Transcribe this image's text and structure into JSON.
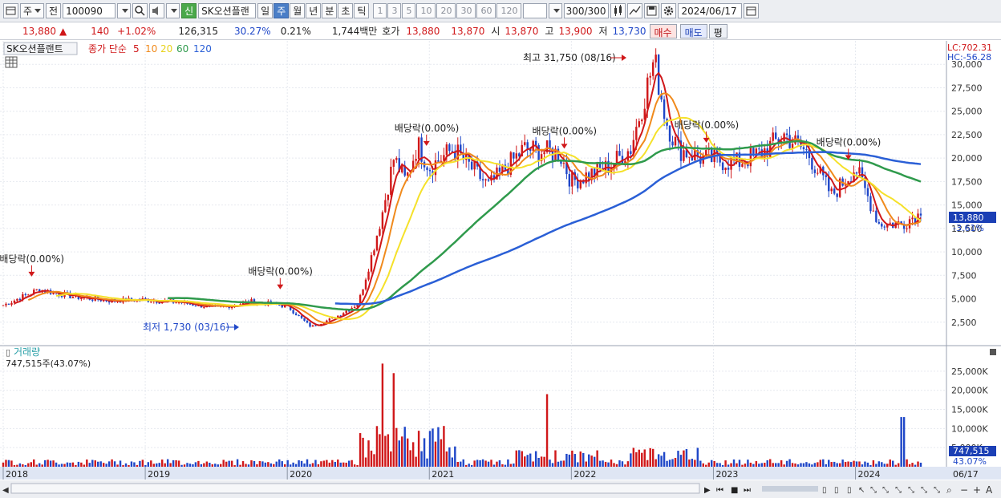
{
  "toolbar": {
    "market_selector": "주",
    "prev_button": "전",
    "stock_code": "100090",
    "new_badge": "신",
    "stock_name": "SK오션플랜",
    "period_tabs": [
      "일",
      "주",
      "월",
      "년",
      "분",
      "초",
      "틱"
    ],
    "selected_period": "주",
    "interval_buttons": [
      "1",
      "3",
      "5",
      "10",
      "20",
      "30",
      "60",
      "120"
    ],
    "count_value": "300",
    "count_total": "/300",
    "date_value": "2024/06/17"
  },
  "quote": {
    "price": "13,880",
    "change_arrow": "▲",
    "change": "140",
    "change_pct": "+1.02%",
    "volume": "126,315",
    "volume_ratio": "30.27%",
    "turnover": "0.21%",
    "amount": "1,744백만",
    "bid_label": "호가",
    "bid1": "13,880",
    "bid2": "13,870",
    "open_label": "시",
    "open": "13,870",
    "high_label": "고",
    "high": "13,900",
    "low_label": "저",
    "low": "13,730",
    "buy_button": "매수",
    "sell_button": "매도",
    "avg_button": "평"
  },
  "legend": {
    "name": "SK오션플랜트",
    "indicator": "종가 단순",
    "periods": [
      "5",
      "10",
      "20",
      "60",
      "120"
    ],
    "colors": [
      "#d0181a",
      "#f08a1c",
      "#f5e12a",
      "#2f9a4c",
      "#2a5fd6"
    ]
  },
  "right_labels": {
    "lc": "LC:702.31",
    "hc": "HC:-56.28",
    "current_price": "13,880",
    "current_pct": "-3.61%",
    "volume_current": "747,515",
    "volume_pct": "43.07%"
  },
  "annotations": {
    "high": "최고 31,750 (08/16)",
    "low": "최저 1,730 (03/16)",
    "dividend": "배당락(0.00%)"
  },
  "volume_panel": {
    "title": "거래량",
    "value": "747,515주(43.07%)"
  },
  "x_axis_labels": [
    "2018",
    "2019",
    "2020",
    "2021",
    "2022",
    "2023",
    "2024",
    "06/17"
  ],
  "price_axis_ticks": [
    "30,000",
    "27,500",
    "25,000",
    "22,500",
    "20,000",
    "17,500",
    "15,000",
    "12,500",
    "10,000",
    "7,500",
    "5,000",
    "2,500"
  ],
  "volume_axis_ticks": [
    "25,000K",
    "20,000K",
    "15,000K",
    "10,000K",
    "5,000K"
  ],
  "chart_data": {
    "type": "line",
    "title": "SK오션플랜트",
    "y_unit": "KRW",
    "ylim": [
      0,
      32500
    ],
    "volume_ylim_k": [
      0,
      27500
    ],
    "keypoints": [
      {
        "x": "2018-01",
        "close": 4300
      },
      {
        "x": "2018-04",
        "close": 6000
      },
      {
        "x": "2018-07",
        "close": 5200
      },
      {
        "x": "2018-10",
        "close": 4800
      },
      {
        "x": "2019-01",
        "close": 4900
      },
      {
        "x": "2019-04",
        "close": 4600
      },
      {
        "x": "2019-07",
        "close": 4000
      },
      {
        "x": "2019-10",
        "close": 4700
      },
      {
        "x": "2020-01",
        "close": 4200
      },
      {
        "x": "2020-03",
        "close": 2000
      },
      {
        "x": "2020-05",
        "close": 3000
      },
      {
        "x": "2020-07",
        "close": 4500
      },
      {
        "x": "2020-08",
        "close": 9000
      },
      {
        "x": "2020-09",
        "close": 14000
      },
      {
        "x": "2020-10",
        "close": 20000
      },
      {
        "x": "2020-11",
        "close": 17500
      },
      {
        "x": "2020-12",
        "close": 21500
      },
      {
        "x": "2021-01",
        "close": 19000
      },
      {
        "x": "2021-03",
        "close": 21000
      },
      {
        "x": "2021-06",
        "close": 17000
      },
      {
        "x": "2021-09",
        "close": 21000
      },
      {
        "x": "2021-12",
        "close": 20500
      },
      {
        "x": "2022-01",
        "close": 17500
      },
      {
        "x": "2022-04",
        "close": 19000
      },
      {
        "x": "2022-06",
        "close": 21000
      },
      {
        "x": "2022-08",
        "close": 30500
      },
      {
        "x": "2022-09",
        "close": 24000
      },
      {
        "x": "2022-10",
        "close": 21000
      },
      {
        "x": "2022-12",
        "close": 20000
      },
      {
        "x": "2023-03",
        "close": 19500
      },
      {
        "x": "2023-05",
        "close": 20500
      },
      {
        "x": "2023-07",
        "close": 22500
      },
      {
        "x": "2023-09",
        "close": 20500
      },
      {
        "x": "2023-11",
        "close": 16000
      },
      {
        "x": "2024-01",
        "close": 19000
      },
      {
        "x": "2024-03",
        "close": 13000
      },
      {
        "x": "2024-05",
        "close": 13000
      },
      {
        "x": "2024-06",
        "close": 13880
      }
    ],
    "moving_averages": [
      {
        "name": "5",
        "color": "#d0181a"
      },
      {
        "name": "10",
        "color": "#f08a1c"
      },
      {
        "name": "20",
        "color": "#f5e12a"
      },
      {
        "name": "60",
        "color": "#2f9a4c"
      },
      {
        "name": "120",
        "color": "#2a5fd6"
      }
    ],
    "volume_spikes_k": [
      {
        "x": "2020-09",
        "value": 27000
      },
      {
        "x": "2020-10",
        "value": 24500
      },
      {
        "x": "2021-11",
        "value": 19000
      },
      {
        "x": "2024-05",
        "value": 13000
      }
    ]
  }
}
